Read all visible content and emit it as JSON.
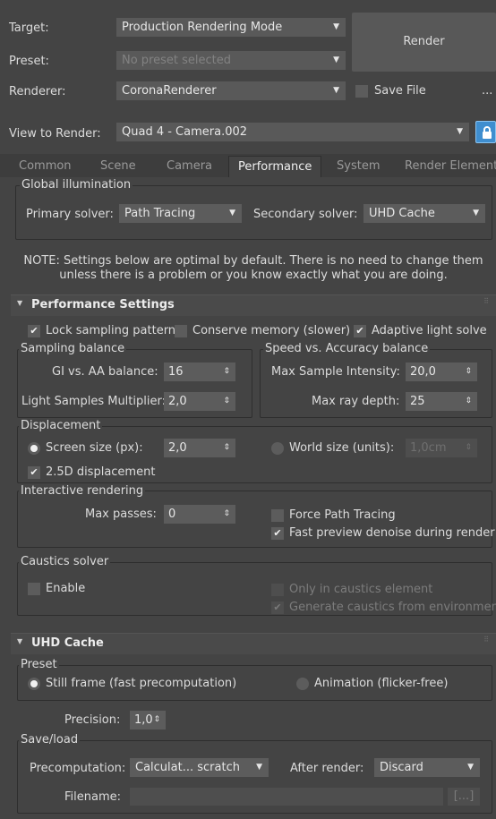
{
  "top": {
    "target_label": "Target:",
    "target_value": "Production Rendering Mode",
    "preset_label": "Preset:",
    "preset_value": "No preset selected",
    "renderer_label": "Renderer:",
    "renderer_value": "CoronaRenderer",
    "render_button": "Render",
    "save_file_label": "Save File",
    "more_label": "...",
    "view_label": "View to Render:",
    "view_value": "Quad 4 - Camera.002",
    "lock_icon": "lock-icon"
  },
  "tabs": [
    {
      "label": "Common"
    },
    {
      "label": "Scene"
    },
    {
      "label": "Camera"
    },
    {
      "label": "Performance"
    },
    {
      "label": "System"
    },
    {
      "label": "Render Elements"
    }
  ],
  "active_tab": "Performance",
  "gi": {
    "title": "Global illumination",
    "primary_label": "Primary solver:",
    "primary_value": "Path Tracing",
    "secondary_label": "Secondary solver:",
    "secondary_value": "UHD Cache"
  },
  "note": {
    "line1": "NOTE: Settings below are optimal by default. There is no need to change them",
    "line2": "unless there is a problem or you know exactly what you are doing."
  },
  "perf": {
    "title": "Performance Settings",
    "lock_sampling": "Lock sampling pattern",
    "conserve_memory": "Conserve memory (slower)",
    "adaptive_light": "Adaptive light solve",
    "sampling_balance_title": "Sampling balance",
    "gi_aa_label": "GI vs. AA balance:",
    "gi_aa_value": "16",
    "light_samples_label": "Light Samples Multiplier:",
    "light_samples_value": "2,0",
    "speed_title": "Speed vs. Accuracy balance",
    "max_intensity_label": "Max Sample Intensity:",
    "max_intensity_value": "20,0",
    "max_ray_label": "Max ray depth:",
    "max_ray_value": "25",
    "displacement_title": "Displacement",
    "screen_size_label": "Screen size (px):",
    "screen_size_value": "2,0",
    "world_size_label": "World size (units):",
    "world_size_value": "1,0cm",
    "disp25_label": "2.5D displacement",
    "interactive_title": "Interactive rendering",
    "max_passes_label": "Max passes:",
    "max_passes_value": "0",
    "force_path_label": "Force Path Tracing",
    "fast_preview_label": "Fast preview denoise during render",
    "caustics_title": "Caustics solver",
    "enable_label": "Enable",
    "only_caustics_label": "Only in caustics element",
    "gen_caustics_label": "Generate caustics from environment"
  },
  "uhd": {
    "title": "UHD Cache",
    "preset_title": "Preset",
    "still_label": "Still frame (fast precomputation)",
    "anim_label": "Animation (flicker-free)",
    "precision_label": "Precision:",
    "precision_value": "1,0",
    "saveload_title": "Save/load",
    "precomp_label": "Precomputation:",
    "precomp_value": "Calculat... scratch",
    "after_label": "After render:",
    "after_value": "Discard",
    "filename_label": "Filename:",
    "filename_value": "",
    "browse_label": "[...]"
  },
  "glyphs": {
    "dropdown_arrow": "▼",
    "spinner_arrow": "⇕",
    "check": "✔",
    "collapse": "▼",
    "grip": "⠿"
  }
}
